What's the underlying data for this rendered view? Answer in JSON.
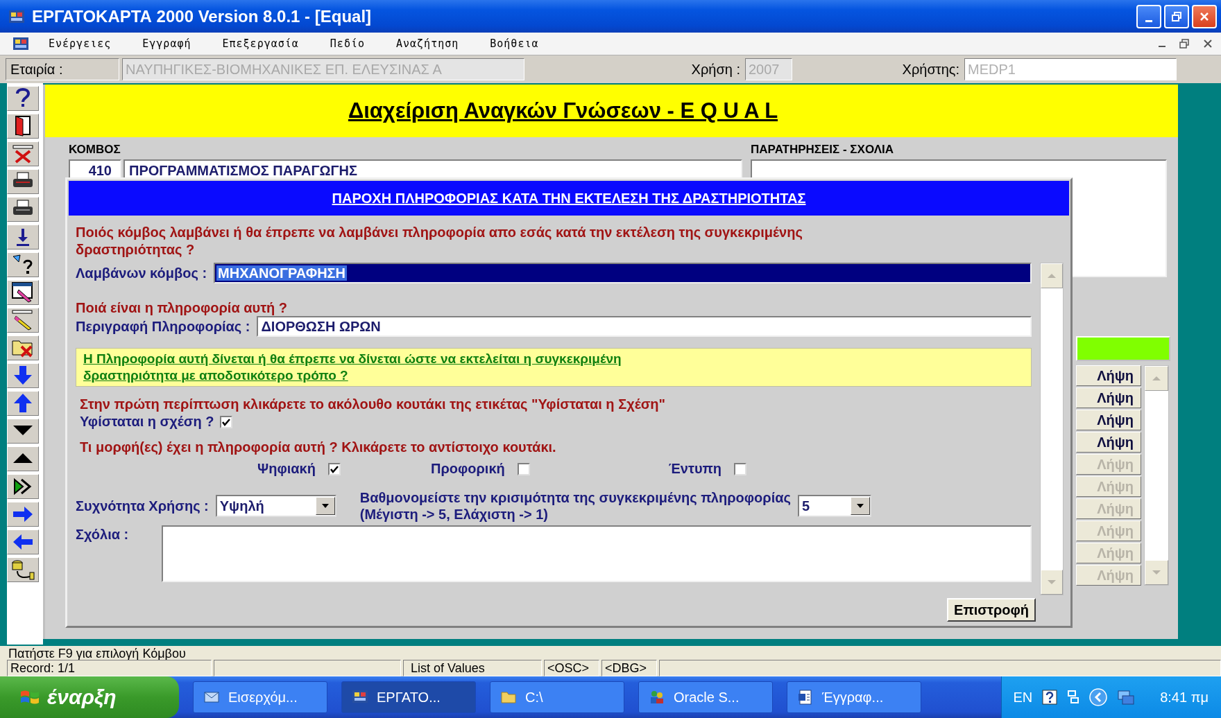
{
  "window": {
    "title": "ΕΡΓΑΤΟΚΑΡΤΑ 2000 Version 8.0.1 - [Equal]"
  },
  "menu": [
    {
      "label": "Ενέργειες"
    },
    {
      "label": "Εγγραφή"
    },
    {
      "label": "Επεξεργασία"
    },
    {
      "label": "Πεδίο"
    },
    {
      "label": "Αναζήτηση"
    },
    {
      "label": "Βοήθεια"
    }
  ],
  "context_bar": {
    "company_label": "Εταιρία :",
    "company": "ΝΑΥΠΗΓΙΚΕΣ-ΒΙΟΜΗΧΑΝΙΚΕΣ ΕΠ. ΕΛΕΥΣΙΝΑΣ Α",
    "year_label": "Χρήση :",
    "year": "2007",
    "user_label": "Χρήστης:",
    "user": "MEDP1"
  },
  "form": {
    "title": "Διαχείριση Αναγκών Γνώσεων - E Q U A L",
    "node_label": "ΚΟΜΒΟΣ",
    "node_code": "410",
    "node_name": "ΠΡΟΓΡΑΜΜΑΤΙΣΜΟΣ ΠΑΡΑΓΩΓΗΣ",
    "remarks_label": "ΠΑΡΑΤΗΡΗΣΕΙΣ - ΣΧΟΛΙΑ",
    "fetch_buttons": [
      {
        "label": "Λήψη",
        "disabled": false
      },
      {
        "label": "Λήψη",
        "disabled": false
      },
      {
        "label": "Λήψη",
        "disabled": false
      },
      {
        "label": "Λήψη",
        "disabled": false
      },
      {
        "label": "Λήψη",
        "disabled": true
      },
      {
        "label": "Λήψη",
        "disabled": true
      },
      {
        "label": "Λήψη",
        "disabled": true
      },
      {
        "label": "Λήψη",
        "disabled": true
      },
      {
        "label": "Λήψη",
        "disabled": true
      },
      {
        "label": "Λήψη",
        "disabled": true
      }
    ]
  },
  "dialog": {
    "title": "ΠΑΡΟΧΗ ΠΛΗΡΟΦΟΡΙΑΣ ΚΑΤΑ ΤΗΝ ΕΚΤΕΛΕΣΗ ΤΗΣ ΔΡΑΣΤΗΡΙΟΤΗΤΑΣ",
    "question": "Ποιός κόμβος λαμβάνει ή θα έπρεπε να λαμβάνει πληροφορία απο εσάς κατά την εκτέλεση της συγκεκριμένης δραστηριότητας ?",
    "receiver_label": "Λαμβάνων κόμβος :",
    "receiver": {
      "value": "ΜΗΧΑΝΟΓΡΑΦΗΣΗ",
      "selected": true
    },
    "info_question": "Ποιά είναι η πληροφορία αυτή ?",
    "description_label": "Περιγραφή Πληροφορίας :",
    "description": "ΔΙΟΡΘΩΣΗ ΩΡΩΝ",
    "note": "Η Πληροφορία αυτή δίνεται ή θα έπρεπε να δίνεται ώστε να εκτελείται η συγκεκριμένη δραστηριότητα με αποδοτικότερο τρόπο ?",
    "instruction": "Στην πρώτη περίπτωση κλικάρετε το ακόλουθο κουτάκι της ετικέτας \"Υφίσταται η Σχέση\"",
    "relation": {
      "label": "Υφίσταται η σχέση ?",
      "checked": true
    },
    "forms_question": "Τι μορφή(ες) έχει η πληροφορία αυτή ? Κλικάρετε το αντίστοιχο κουτάκι.",
    "forms": [
      {
        "label": "Ψηφιακή",
        "checked": true
      },
      {
        "label": "Προφορική",
        "checked": false
      },
      {
        "label": "Έντυπη",
        "checked": false
      }
    ],
    "frequency_label": "Συχνότητα Χρήσης :",
    "frequency": "Υψηλή",
    "criticality_label": "Βαθμονομείστε την κρισιμότητα της συγκεκριμένης πληροφορίας",
    "criticality_hint": "(Μέγιστη -> 5, Ελάχιστη -> 1)",
    "criticality": "5",
    "comments_label": "Σχόλια :",
    "return_button": "Επιστροφή"
  },
  "status": {
    "message": "Πατήστε F9 για επιλογή Κόμβου",
    "record": "Record: 1/1",
    "lov": "List of Values",
    "osc": "<OSC>",
    "dbg": "<DBG>"
  },
  "taskbar": {
    "start": "έναρξη",
    "tasks": [
      {
        "label": "Εισερχόμ...",
        "selected": false
      },
      {
        "label": "ΕΡΓΑΤΟ...",
        "selected": true
      },
      {
        "label": "C:\\",
        "selected": false
      },
      {
        "label": "Oracle S...",
        "selected": false
      },
      {
        "label": "Έγγραφ...",
        "selected": false
      }
    ],
    "language": "EN",
    "clock": "8:41 πμ"
  }
}
